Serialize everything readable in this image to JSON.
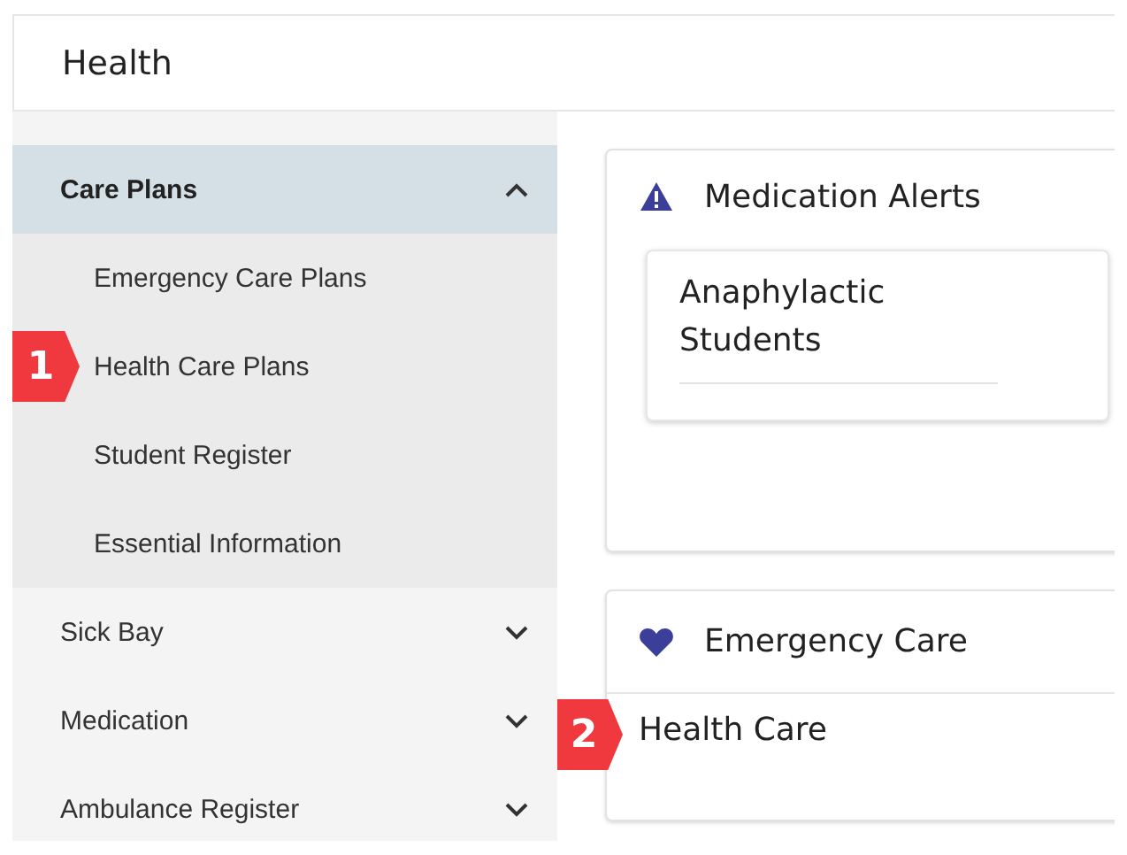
{
  "header": {
    "title": "Health"
  },
  "sidebar": {
    "groups": [
      {
        "label": "Care Plans",
        "expanded": true,
        "children": [
          {
            "label": "Emergency Care Plans"
          },
          {
            "label": "Health Care Plans",
            "callout": "1"
          },
          {
            "label": "Student Register"
          },
          {
            "label": "Essential Information"
          }
        ]
      },
      {
        "label": "Sick Bay",
        "expanded": false
      },
      {
        "label": "Medication",
        "expanded": false
      },
      {
        "label": "Ambulance Register",
        "expanded": false
      }
    ]
  },
  "cards": [
    {
      "kind": "alerts",
      "title": "Medication Alerts",
      "items": [
        {
          "title": "Anaphylactic Students"
        }
      ]
    },
    {
      "kind": "emergency",
      "title": "Emergency Care",
      "body": "Health Care",
      "callout": "2"
    }
  ]
}
